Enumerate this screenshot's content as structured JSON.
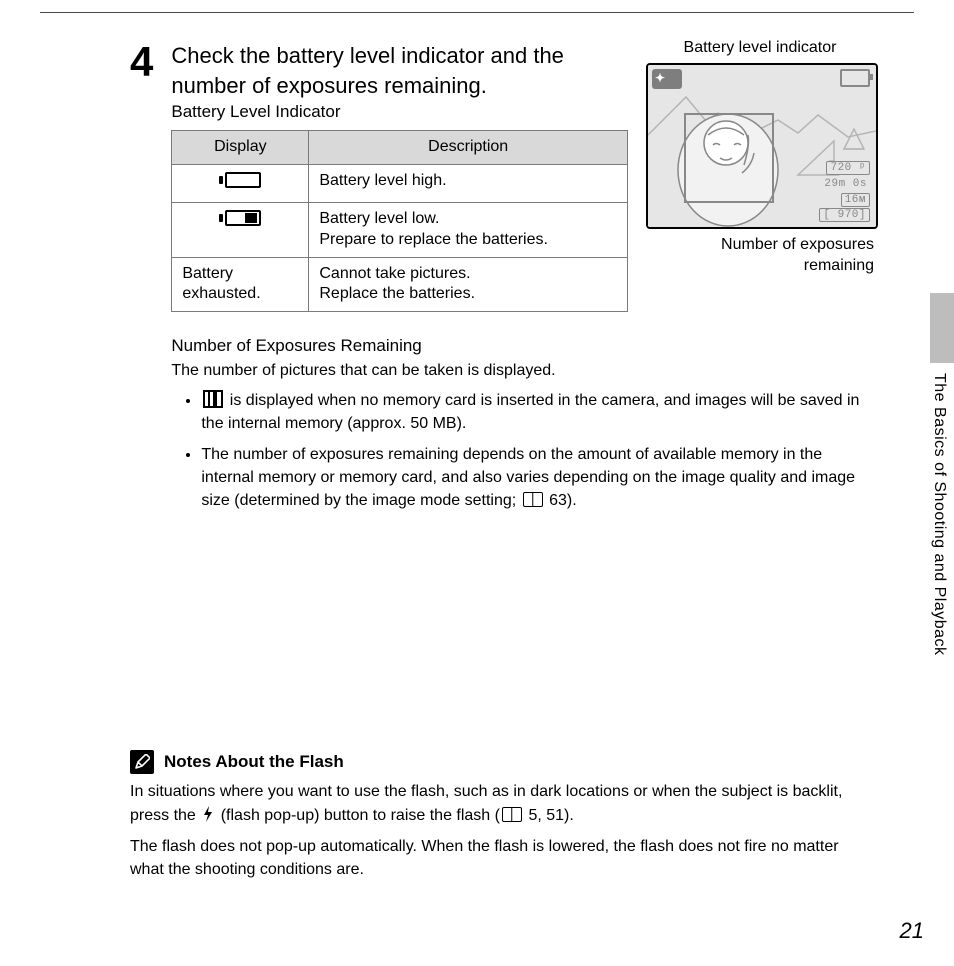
{
  "section_title": "The Basics of Shooting and Playback",
  "page_number": "21",
  "step": {
    "number": "4",
    "title_line1": "Check the battery level indicator and the",
    "title_line2": "number of exposures remaining."
  },
  "battery_indicator": {
    "subhead": "Battery Level Indicator",
    "headers": {
      "display": "Display",
      "description": "Description"
    },
    "rows": {
      "r1": {
        "display": "battery-high-icon",
        "description": "Battery level high."
      },
      "r2": {
        "display": "battery-low-icon",
        "desc_l1": "Battery level low.",
        "desc_l2": "Prepare to replace the batteries."
      },
      "r3": {
        "disp_l1": "Battery",
        "disp_l2": "exhausted.",
        "desc_l1": "Cannot take pictures.",
        "desc_l2": "Replace the batteries."
      }
    }
  },
  "exposures": {
    "subhead": "Number of Exposures Remaining",
    "intro": "The number of pictures that can be taken is displayed.",
    "bullet1_a": " is displayed when no memory card is inserted in the camera, and images will be saved in the internal memory (approx. 50 MB).",
    "bullet2_a": "The number of exposures remaining depends on the amount of available memory in the internal memory or memory card, and also varies depending on the image quality and image size (determined by the image mode setting; ",
    "bullet2_ref": "63).",
    "internal_memory_mb": 50,
    "page_ref_image_mode": 63
  },
  "preview": {
    "caption_top": "Battery level indicator",
    "caption_bottom_l1": "Number of exposures",
    "caption_bottom_l2": "remaining",
    "scene_badge": "⚈",
    "res": "720 ᵖ",
    "time": "29m 0s",
    "size": "16ᴍ",
    "count": "[  970]"
  },
  "notes": {
    "title": "Notes About the Flash",
    "p1_a": "In situations where you want to use the flash, such as in dark locations or when the subject is backlit, press the ",
    "p1_b": " (flash pop-up) button to raise the flash (",
    "p1_refs": "5, 51).",
    "p2": "The flash does not pop-up automatically. When the flash is lowered, the flash does not fire no matter what the shooting conditions are.",
    "page_refs": [
      5,
      51
    ]
  }
}
